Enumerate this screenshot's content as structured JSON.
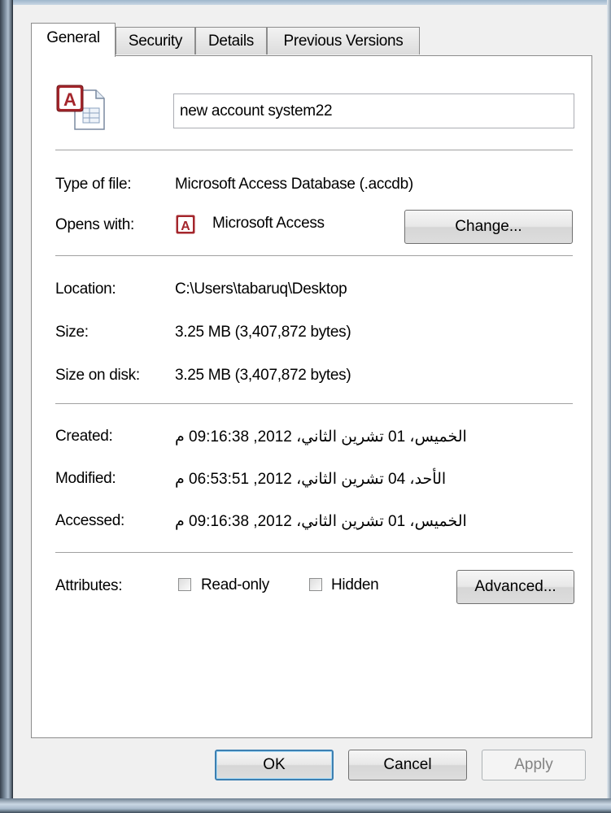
{
  "tabs": [
    "General",
    "Security",
    "Details",
    "Previous Versions"
  ],
  "file": {
    "icon": "access-database-file-icon",
    "name": "new account system22"
  },
  "type_of_file": {
    "label": "Type of file:",
    "value": "Microsoft Access Database (.accdb)"
  },
  "opens_with": {
    "label": "Opens with:",
    "icon": "microsoft-access-icon",
    "app": "Microsoft Access",
    "change_button": "Change..."
  },
  "location": {
    "label": "Location:",
    "value": "C:\\Users\\tabaruq\\Desktop"
  },
  "size": {
    "label": "Size:",
    "value": "3.25 MB (3,407,872 bytes)"
  },
  "size_on_disk": {
    "label": "Size on disk:",
    "value": "3.25 MB (3,407,872 bytes)"
  },
  "created": {
    "label": "Created:",
    "value": "الخميس، 01 تشرين الثاني، 2012, 09:16:38 م"
  },
  "modified": {
    "label": "Modified:",
    "value": "الأحد، 04 تشرين الثاني، 2012, 06:53:51 م"
  },
  "accessed": {
    "label": "Accessed:",
    "value": "الخميس، 01 تشرين الثاني، 2012, 09:16:38 م"
  },
  "attributes": {
    "label": "Attributes:",
    "read_only": {
      "label": "Read-only",
      "checked": false
    },
    "hidden": {
      "label": "Hidden",
      "checked": false
    },
    "advanced_button": "Advanced..."
  },
  "buttons": {
    "ok": "OK",
    "cancel": "Cancel",
    "apply": "Apply"
  },
  "colors": {
    "access_red": "#a4262c",
    "default_button_border": "#3c7fb1"
  }
}
